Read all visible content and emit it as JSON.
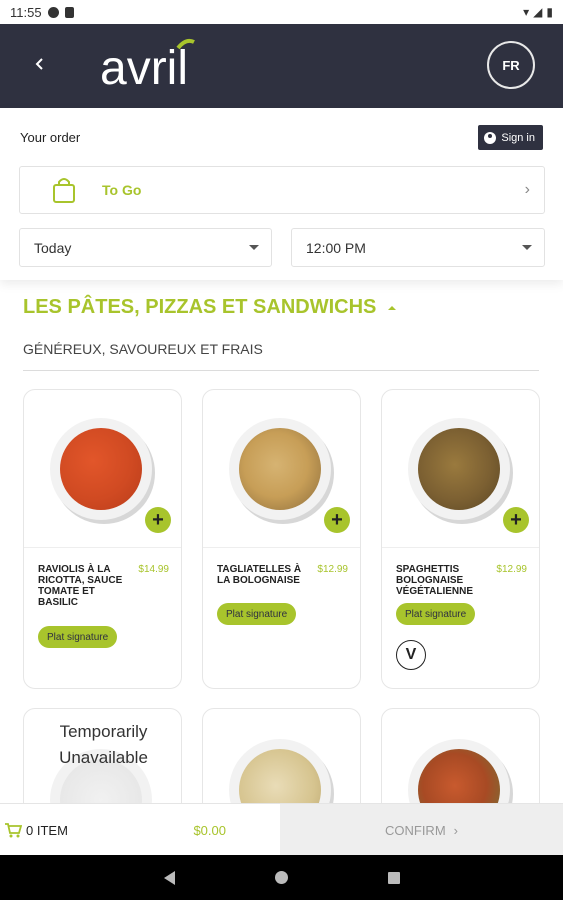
{
  "status_bar": {
    "time": "11:55"
  },
  "header": {
    "logo_text": "avril",
    "lang_button": "FR"
  },
  "order": {
    "your_order_label": "Your order",
    "sign_in_label": "Sign in",
    "mode_label": "To Go",
    "day_value": "Today",
    "time_value": "12:00 PM"
  },
  "section": {
    "title": "LES PÂTES, PIZZAS ET SANDWICHS",
    "subtitle": "GÉNÉREUX, SAVOUREUX ET FRAIS"
  },
  "items": [
    {
      "name": "RAVIOLIS À LA RICOTTA, SAUCE TOMATE ET BASILIC",
      "price": "$14.99",
      "badge": "Plat signature"
    },
    {
      "name": "TAGLIATELLES À LA BOLOGNAISE",
      "price": "$12.99",
      "badge": "Plat signature"
    },
    {
      "name": "SPAGHETTIS BOLOGNAISE VÉGÉTALIENNE",
      "price": "$12.99",
      "badge": "Plat signature",
      "veg_mark": "V"
    }
  ],
  "second_row": {
    "unavailable_label": "Temporarily Unavailable"
  },
  "cart": {
    "items_label": "0 ITEM",
    "total": "$0.00",
    "confirm_label": "CONFIRM"
  },
  "colors": {
    "accent": "#a8c42c",
    "header_bg": "#2f3140"
  },
  "icons": [
    "back-arrow-icon",
    "bag-icon",
    "chevron-right-icon",
    "caret-down-icon",
    "user-icon",
    "cart-icon",
    "plus-icon",
    "vegan-icon"
  ]
}
